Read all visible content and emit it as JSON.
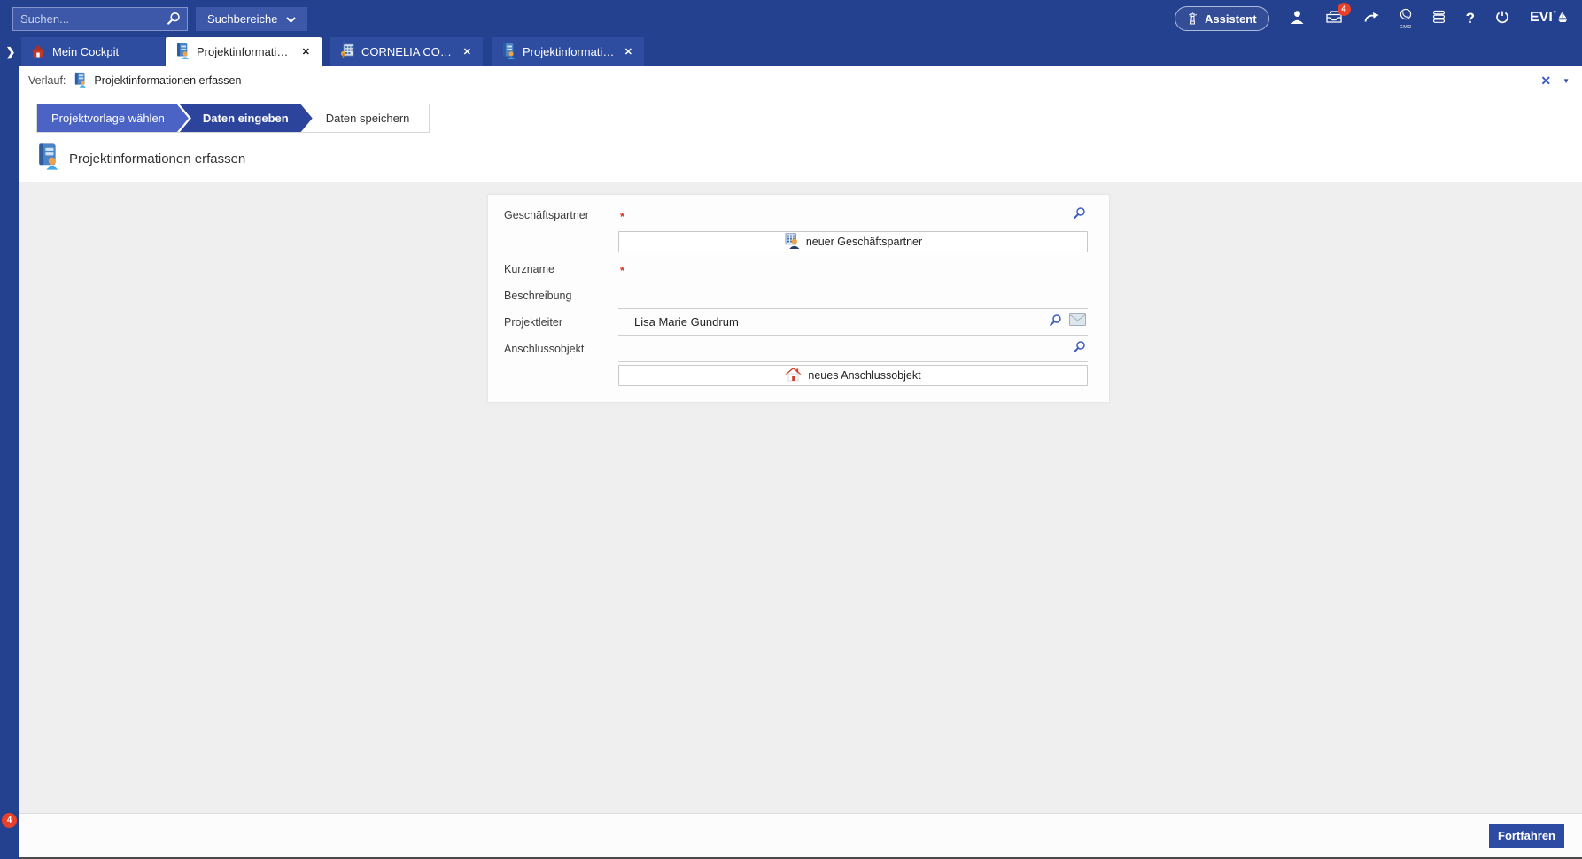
{
  "glyphs": {
    "close": "✕",
    "chevron_right": "❯",
    "caret_down": "▼",
    "help": "?"
  },
  "topbar": {
    "search_placeholder": "Suchen...",
    "search_scope_label": "Suchbereiche",
    "assistant_label": "Assistent",
    "inbox_badge": "4",
    "globe_label": "GMD",
    "logo_text": "EVI",
    "logo_mark": "°"
  },
  "tabbar": {
    "tabs": [
      {
        "label": "Mein Cockpit"
      },
      {
        "label": "Projektinformatione..."
      },
      {
        "label": "CORNELIA COMPLE..."
      },
      {
        "label": "Projektinformatione..."
      }
    ]
  },
  "history_bar": {
    "label": "Verlauf:",
    "item_label": "Projektinformationen erfassen"
  },
  "wizard": {
    "steps": [
      {
        "label": "Projektvorlage wählen",
        "state": "done"
      },
      {
        "label": "Daten eingeben",
        "state": "active"
      },
      {
        "label": "Daten speichern",
        "state": "upcoming"
      }
    ]
  },
  "page": {
    "title": "Projektinformationen erfassen"
  },
  "form": {
    "required_marker": "*",
    "fields": [
      {
        "label": "Geschäftspartner",
        "required": true,
        "value": ""
      },
      {
        "label": "Kurzname",
        "required": true,
        "value": ""
      },
      {
        "label": "Beschreibung",
        "required": false,
        "value": ""
      },
      {
        "label": "Projektleiter",
        "required": false,
        "value": "Lisa Marie Gundrum"
      },
      {
        "label": "Anschlussobjekt",
        "required": false,
        "value": ""
      }
    ],
    "buttons": {
      "new_business_partner": "neuer Geschäftspartner",
      "new_connection_object": "neues Anschlussobjekt"
    }
  },
  "footer": {
    "continue_label": "Fortfahren"
  },
  "notifications": {
    "bottom_left_badge": "4"
  },
  "colors": {
    "topbar": "#24418f",
    "accent": "#2d4ba3",
    "step_done": "#4a63c4",
    "badge_red": "#e8402a"
  }
}
